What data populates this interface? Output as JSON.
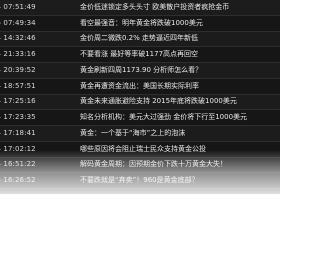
{
  "news": {
    "items": [
      {
        "time": "04 07:51:49",
        "title": "金价低迷锁定多头头寸 欧美散户投资者疯抢金币"
      },
      {
        "time": "05 07:49:34",
        "title": "看空最强音：明年黄金将跌破1000美元"
      },
      {
        "time": "04 14:32:46",
        "title": "金价周二微跌0.2% 走势逼近四年新低"
      },
      {
        "time": "04 21:33:16",
        "title": "不要看涨 最好等率破1177高点再回空"
      },
      {
        "time": "04 20:39:52",
        "title": "黄金刷新四周1173.90 分析师怎么看？"
      },
      {
        "time": "04 18:57:51",
        "title": "黄金再遭资金流出：美国长期实际利率"
      },
      {
        "time": "04 17:25:16",
        "title": "黄金未来通胀避险支持 2015年底将跌破1000美元"
      },
      {
        "time": "04 17:23:35",
        "title": "知名分析机构：美元大过强劲 金价将下行至1000美元"
      },
      {
        "time": "04 17:18:41",
        "title": "黄金：一个基于“海市”之上的泡沫"
      },
      {
        "time": "04 17:02:12",
        "title": "哪些原因将会阻止瑞士民众支持黄金公投"
      },
      {
        "time": "04 16:51:22",
        "title": "解码黄金周期：因预期金价下跌十万黄金大失！"
      },
      {
        "time": "04 16:26:52",
        "title": "不要跌就是“弃卖”！960是黄金底部？"
      }
    ]
  }
}
